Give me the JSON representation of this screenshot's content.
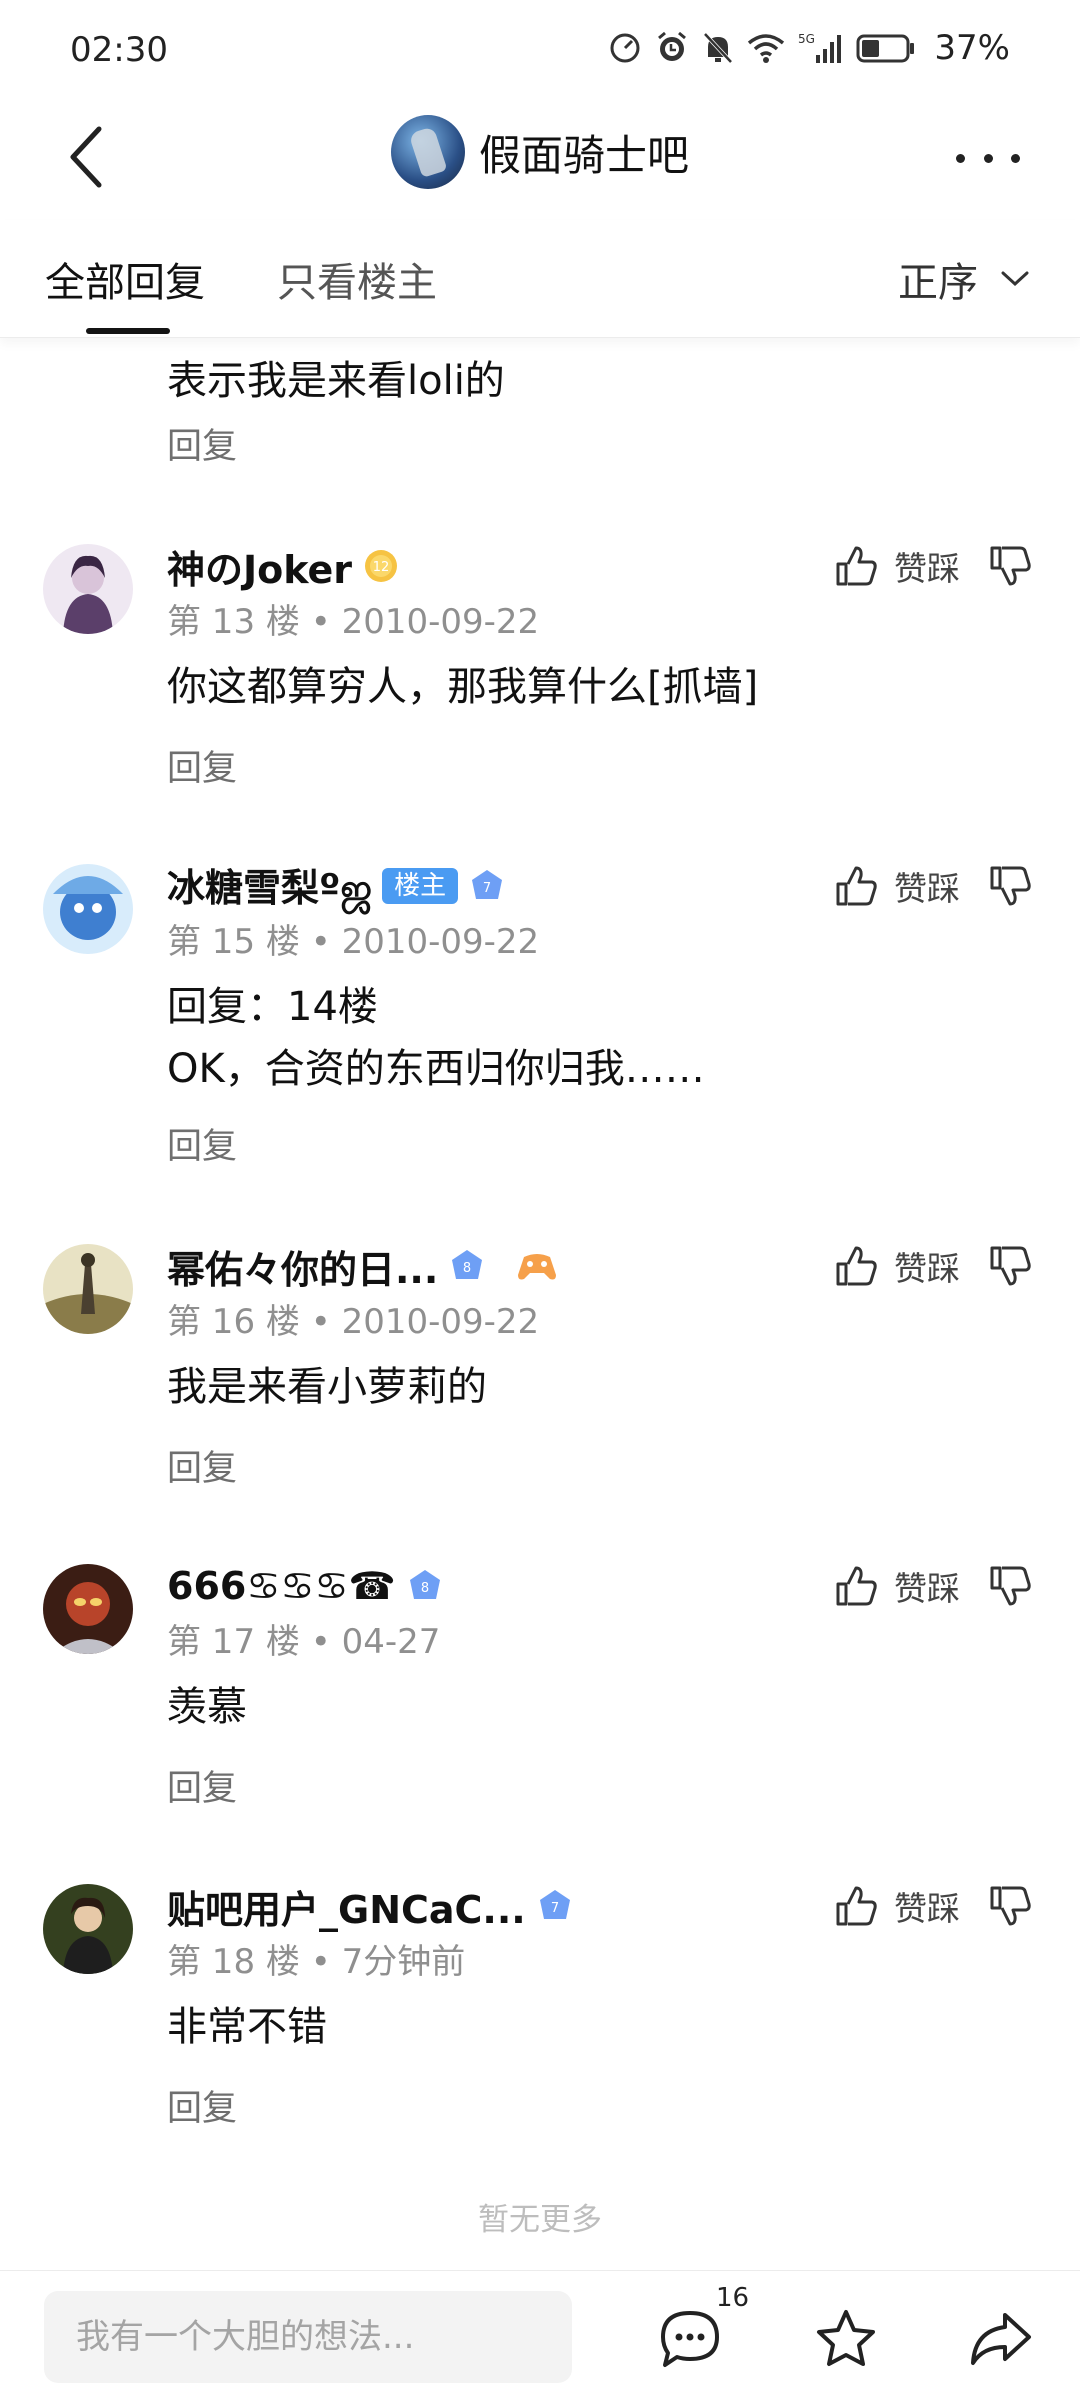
{
  "status_bar": {
    "time": "02:30",
    "battery_percent": "37%",
    "network": "5G",
    "icons": [
      "speedometer-icon",
      "alarm-icon",
      "mute-icon",
      "wifi-icon",
      "signal-icon",
      "battery-icon"
    ]
  },
  "header": {
    "forum_name": "假面骑士吧",
    "back_icon": "back-arrow-icon",
    "more_icon": "more-dots-icon"
  },
  "tabs": {
    "all_replies": "全部回复",
    "owner_only": "只看楼主",
    "sort_label": "正序"
  },
  "partial_post": {
    "text": "表示我是来看loli的",
    "reply_label": "回复"
  },
  "posts": [
    {
      "username": "神のJoker",
      "level": "12",
      "badge_color": "#f6c343",
      "floor": "第 13 楼",
      "date": "2010-09-22",
      "lines": [
        "你这都算穷人，那我算什么[抓墙]"
      ],
      "vote_label": "赞踩",
      "reply_label": "回复"
    },
    {
      "username": "冰糖雪梨ºஜ",
      "owner_tag": "楼主",
      "level": "7",
      "badge_color": "#6e9ff5",
      "floor": "第 15 楼",
      "date": "2010-09-22",
      "lines": [
        "回复：14楼",
        "OK，合资的东西归你归我……"
      ],
      "vote_label": "赞踩",
      "reply_label": "回复"
    },
    {
      "username": "幂佑々你的日...",
      "level": "8",
      "badge_color": "#6e9ff5",
      "extra_icon": "game-controller-icon",
      "floor": "第 16 楼",
      "date": "2010-09-22",
      "lines": [
        "我是来看小萝莉的"
      ],
      "vote_label": "赞踩",
      "reply_label": "回复"
    },
    {
      "username": "666♋♋♋☎",
      "level": "8",
      "badge_color": "#6e9ff5",
      "floor": "第 17 楼",
      "date": "04-27",
      "lines": [
        "羡慕"
      ],
      "vote_label": "赞踩",
      "reply_label": "回复"
    },
    {
      "username": "贴吧用户_GNCaC...",
      "level": "7",
      "badge_color": "#6e9ff5",
      "floor": "第 18 楼",
      "date": "7分钟前",
      "lines": [
        "非常不错"
      ],
      "vote_label": "赞踩",
      "reply_label": "回复"
    }
  ],
  "footer": {
    "no_more": "暂无更多",
    "input_placeholder": "我有一个大胆的想法...",
    "comment_count": "16",
    "icons": [
      "comment-icon",
      "star-icon",
      "share-icon"
    ]
  },
  "colors": {
    "text_primary": "#141414",
    "text_secondary": "#8f8f8f",
    "owner_badge": "#4a9bf2",
    "level_badge_blue": "#6e9ff5",
    "level_badge_gold": "#f6c343"
  }
}
